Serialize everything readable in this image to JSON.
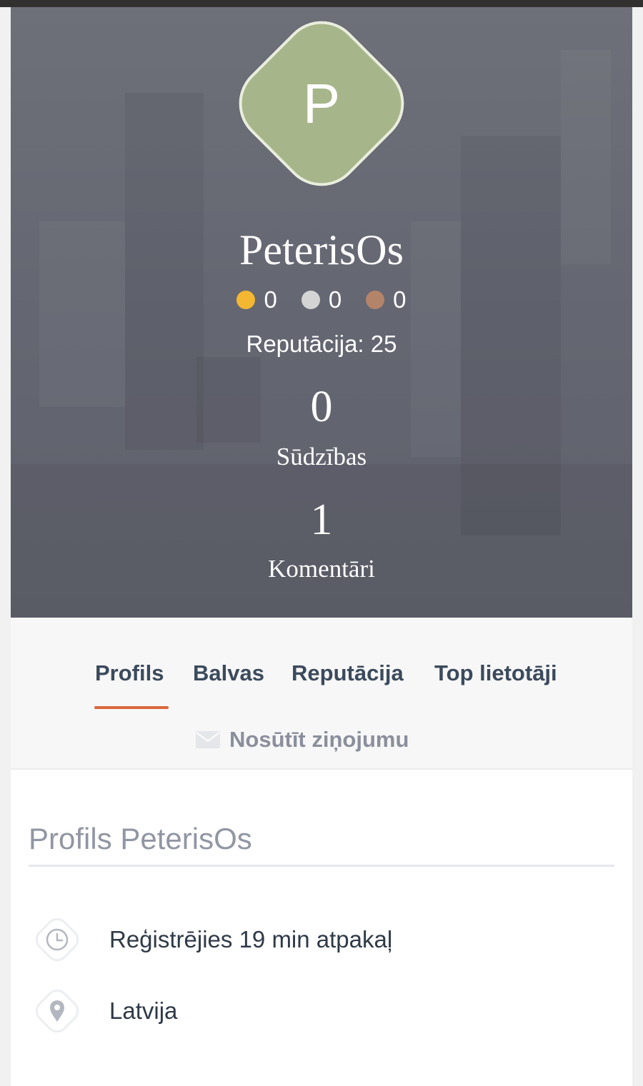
{
  "profile": {
    "avatar_letter": "P",
    "username": "PeterisOs",
    "medals": [
      {
        "name": "gold",
        "color": "#f4b731",
        "count": "0"
      },
      {
        "name": "silver",
        "color": "#d4d4d4",
        "count": "0"
      },
      {
        "name": "bronze",
        "color": "#b4846a",
        "count": "0"
      }
    ],
    "reputation": "Reputācija: 25",
    "stats": [
      {
        "value": "0",
        "label": "Sūdzības"
      },
      {
        "value": "1",
        "label": "Komentāri"
      }
    ]
  },
  "tabs": [
    {
      "label": "Profils",
      "active": true
    },
    {
      "label": "Balvas",
      "active": false
    },
    {
      "label": "Reputācija",
      "active": false
    },
    {
      "label": "Top lietotāji",
      "active": false
    }
  ],
  "message_label": "Nosūtīt ziņojumu",
  "details": {
    "title": "Profils PeterisOs",
    "registered": "Reģistrējies 19 min atpakaļ",
    "location": "Latvija"
  },
  "colors": {
    "accent": "#d9683b",
    "avatar_bg": "#a7b58a"
  },
  "icons": [
    "envelope-icon",
    "clock-icon",
    "map-pin-icon"
  ]
}
